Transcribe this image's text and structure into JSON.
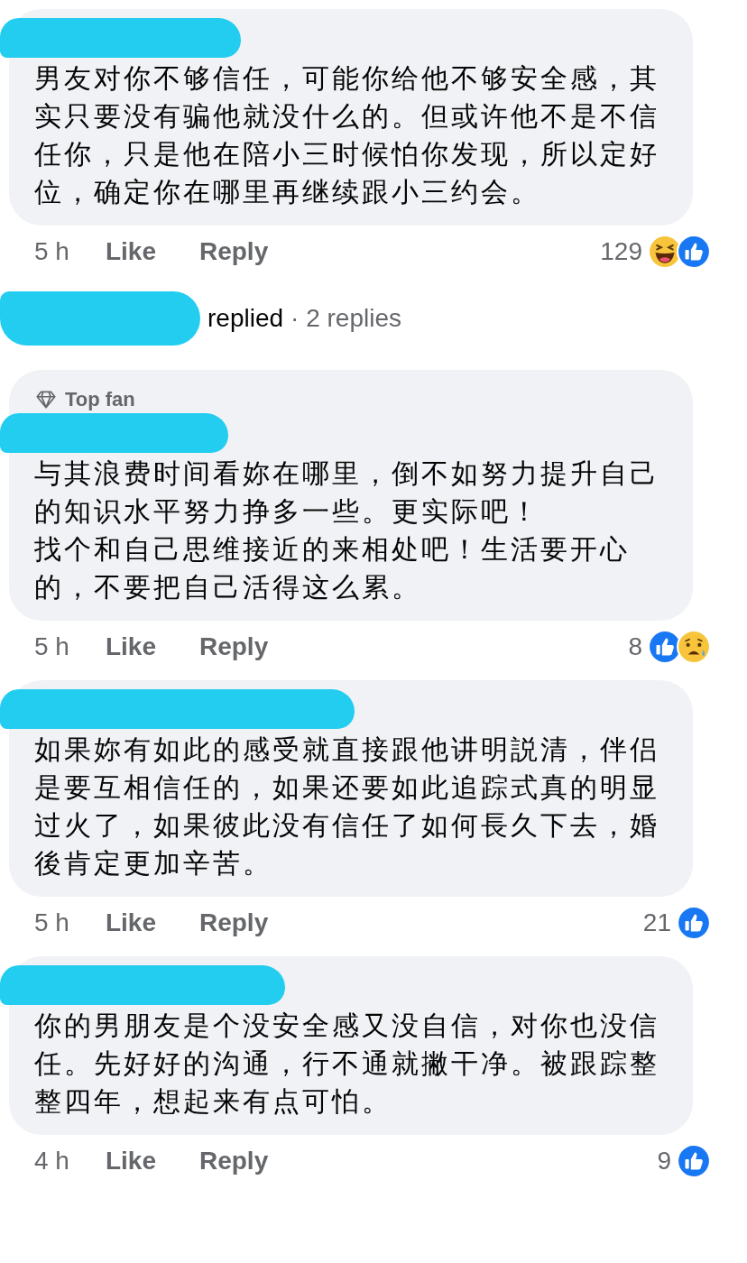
{
  "comments": [
    {
      "paragraphs": [
        "男友对你不够信任，可能你给他不够安全感，其实只要没有骗他就没什么的。但或许他不是不信任你，只是他在陪小三时候怕你发现，所以定好位，确定你在哪里再继续跟小三约会。"
      ],
      "time": "5 h",
      "like": "Like",
      "reply": "Reply",
      "reaction_count": "129",
      "reactions": [
        {
          "kind": "haha"
        },
        {
          "kind": "like"
        }
      ],
      "replies": {
        "who": "replied",
        "count": "· 2 replies"
      }
    },
    {
      "badge": "Top fan",
      "paragraphs": [
        "与其浪费时间看妳在哪里，倒不如努力提升自己的知识水平努力挣多一些。更实际吧！",
        "找个和自己思维接近的来相处吧！生活要开心的，不要把自己活得这么累。"
      ],
      "time": "5 h",
      "like": "Like",
      "reply": "Reply",
      "reaction_count": "8",
      "reactions": [
        {
          "kind": "like"
        },
        {
          "kind": "sad"
        }
      ]
    },
    {
      "paragraphs": [
        "如果妳有如此的感受就直接跟他讲明説清，伴侣是要互相信任的，如果还要如此追踪式真的明显过火了，如果彼此没有信任了如何長久下去，婚後肯定更加辛苦。"
      ],
      "time": "5 h",
      "like": "Like",
      "reply": "Reply",
      "reaction_count": "21",
      "reactions": [
        {
          "kind": "like"
        }
      ]
    },
    {
      "paragraphs": [
        "你的男朋友是个没安全感又没自信，对你也没信任。先好好的沟通，行不通就撇干净。被跟踪整整四年，想起来有点可怕。"
      ],
      "time": "4 h",
      "like": "Like",
      "reply": "Reply",
      "reaction_count": "9",
      "reactions": [
        {
          "kind": "like"
        }
      ]
    }
  ]
}
